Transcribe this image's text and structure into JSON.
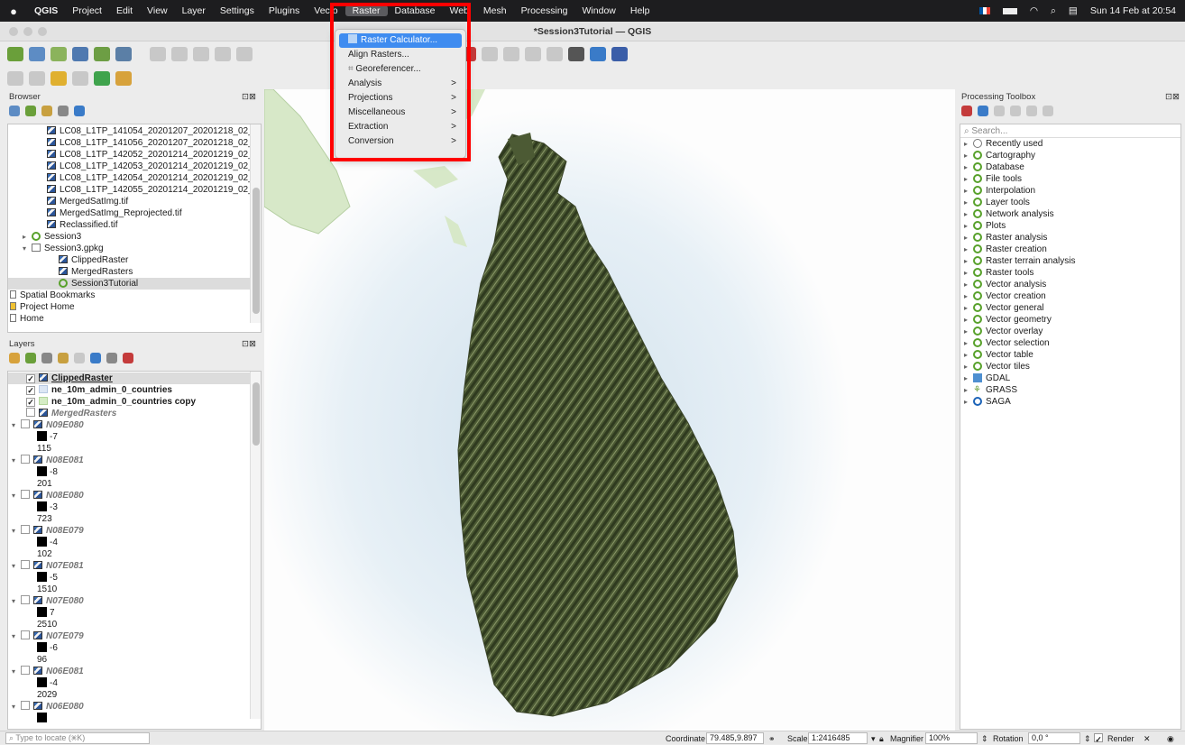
{
  "menubar": {
    "app": "QGIS",
    "items": [
      "Project",
      "Edit",
      "View",
      "Layer",
      "Settings",
      "Plugins",
      "Vecto",
      "Raster",
      "Database",
      "Web",
      "Mesh",
      "Processing",
      "Window",
      "Help"
    ],
    "clock": "Sun 14 Feb at 20:54"
  },
  "window": {
    "title": "*Session3Tutorial — QGIS"
  },
  "raster_menu": {
    "items": [
      {
        "label": "Raster Calculator...",
        "submenu": false
      },
      {
        "label": "Align Rasters...",
        "submenu": false
      },
      {
        "label": "Georeferencer...",
        "submenu": false
      },
      {
        "label": "Analysis",
        "submenu": true
      },
      {
        "label": "Projections",
        "submenu": true
      },
      {
        "label": "Miscellaneous",
        "submenu": true
      },
      {
        "label": "Extraction",
        "submenu": true
      },
      {
        "label": "Conversion",
        "submenu": true
      }
    ],
    "chevron": ">"
  },
  "browser": {
    "title": "Browser",
    "items": [
      "LC08_L1TP_141054_20201207_20201218_02_",
      "LC08_L1TP_141056_20201207_20201218_02_",
      "LC08_L1TP_142052_20201214_20201219_02_",
      "LC08_L1TP_142053_20201214_20201219_02_",
      "LC08_L1TP_142054_20201214_20201219_02_",
      "LC08_L1TP_142055_20201214_20201219_02_",
      "MergedSatImg.tif",
      "MergedSatImg_Reprojected.tif",
      "Reclassified.tif",
      "Session3",
      "Session3.gpkg",
      "ClippedRaster",
      "MergedRasters",
      "Session3Tutorial",
      "Spatial Bookmarks",
      "Project Home",
      "Home"
    ]
  },
  "layers": {
    "title": "Layers",
    "top": [
      {
        "name": "ClippedRaster",
        "checked": "✓"
      },
      {
        "name": "ne_10m_admin_0_countries",
        "checked": "✓"
      },
      {
        "name": "ne_10m_admin_0_countries copy",
        "checked": "✓"
      },
      {
        "name": "MergedRasters",
        "checked": ""
      }
    ],
    "groups": [
      {
        "name": "N09E080",
        "min": "-7",
        "max": "115"
      },
      {
        "name": "N08E081",
        "min": "-8",
        "max": "201"
      },
      {
        "name": "N08E080",
        "min": "-3",
        "max": "723"
      },
      {
        "name": "N08E079",
        "min": "-4",
        "max": "102"
      },
      {
        "name": "N07E081",
        "min": "-5",
        "max": "1510"
      },
      {
        "name": "N07E080",
        "min": "7",
        "max": "2510"
      },
      {
        "name": "N07E079",
        "min": "-6",
        "max": "96"
      },
      {
        "name": "N06E081",
        "min": "-4",
        "max": "2029"
      },
      {
        "name": "N06E080",
        "min": "",
        "max": ""
      }
    ]
  },
  "toolbox": {
    "title": "Processing Toolbox",
    "search_placeholder": "Search...",
    "items": [
      {
        "label": "Recently used",
        "icon": "clock-icon"
      },
      {
        "label": "Cartography",
        "icon": "qgis-icon"
      },
      {
        "label": "Database",
        "icon": "qgis-icon"
      },
      {
        "label": "File tools",
        "icon": "qgis-icon"
      },
      {
        "label": "Interpolation",
        "icon": "qgis-icon"
      },
      {
        "label": "Layer tools",
        "icon": "qgis-icon"
      },
      {
        "label": "Network analysis",
        "icon": "qgis-icon"
      },
      {
        "label": "Plots",
        "icon": "qgis-icon"
      },
      {
        "label": "Raster analysis",
        "icon": "qgis-icon"
      },
      {
        "label": "Raster creation",
        "icon": "qgis-icon"
      },
      {
        "label": "Raster terrain analysis",
        "icon": "qgis-icon"
      },
      {
        "label": "Raster tools",
        "icon": "qgis-icon"
      },
      {
        "label": "Vector analysis",
        "icon": "qgis-icon"
      },
      {
        "label": "Vector creation",
        "icon": "qgis-icon"
      },
      {
        "label": "Vector general",
        "icon": "qgis-icon"
      },
      {
        "label": "Vector geometry",
        "icon": "qgis-icon"
      },
      {
        "label": "Vector overlay",
        "icon": "qgis-icon"
      },
      {
        "label": "Vector selection",
        "icon": "qgis-icon"
      },
      {
        "label": "Vector table",
        "icon": "qgis-icon"
      },
      {
        "label": "Vector tiles",
        "icon": "qgis-icon"
      },
      {
        "label": "GDAL",
        "icon": "gdal-icon"
      },
      {
        "label": "GRASS",
        "icon": "grass-icon"
      },
      {
        "label": "SAGA",
        "icon": "saga-icon"
      }
    ]
  },
  "statusbar": {
    "locate_placeholder": "Type to locate (⌘K)",
    "coordinate_label": "Coordinate",
    "coordinate_value": "79.485,9.897",
    "scale_label": "Scale",
    "scale_value": "1:2416485",
    "magnifier_label": "Magnifier",
    "magnifier_value": "100%",
    "rotation_label": "Rotation",
    "rotation_value": "0,0 °",
    "render_label": "Render"
  },
  "colors": {
    "accent": "#3f8cf0",
    "highlight_box": "#ff0000",
    "terrain": "#4c5a34"
  }
}
